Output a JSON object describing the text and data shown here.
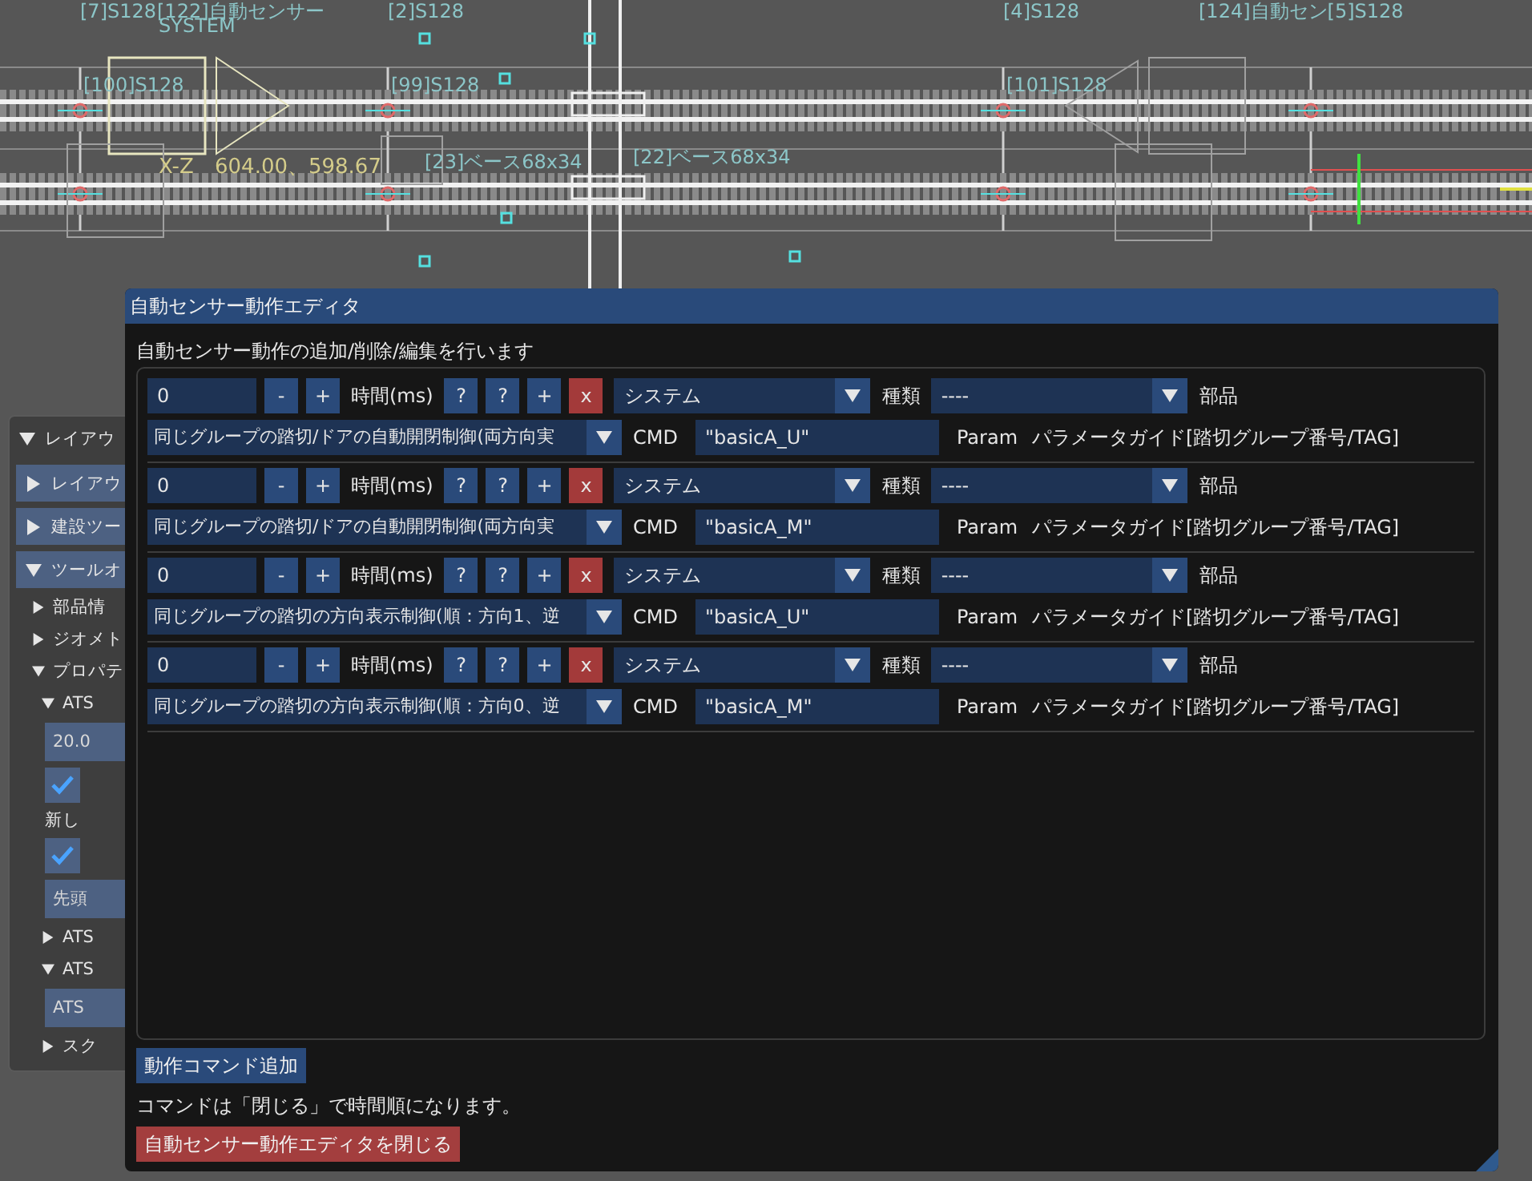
{
  "canvas": {
    "labels": [
      {
        "kind": "label",
        "text": "[7]S128"
      },
      {
        "kind": "label",
        "text": "[122]自動センサー"
      },
      {
        "kind": "label",
        "text": "SYSTEM"
      },
      {
        "kind": "label",
        "text": "[2]S128"
      },
      {
        "kind": "label",
        "text": "[4]S128"
      },
      {
        "kind": "label",
        "text": "[124]自動セン[5]S128"
      },
      {
        "kind": "label",
        "text": "[100]S128"
      },
      {
        "kind": "label",
        "text": "[99]S128"
      },
      {
        "kind": "label",
        "text": "[101]S128"
      },
      {
        "kind": "coordinate",
        "text": "X-Z"
      },
      {
        "kind": "coordinate",
        "text": "604.00、598.67"
      },
      {
        "kind": "label",
        "text": "[23]ベース68x34"
      },
      {
        "kind": "label",
        "text": "[22]ベース68x34"
      }
    ]
  },
  "side_panel": {
    "title": "レイアウ",
    "expanded": true,
    "items": [
      {
        "kind": "button",
        "label": "レイアウ",
        "expanded": false
      },
      {
        "kind": "button",
        "label": "建設ツー",
        "expanded": false
      },
      {
        "kind": "button",
        "label": "ツールオ",
        "expanded": true,
        "children": [
          {
            "kind": "node",
            "label": "部品情",
            "expanded": false
          },
          {
            "kind": "node",
            "label": "ジオメト",
            "expanded": false
          },
          {
            "kind": "node",
            "label": "プロパテ",
            "expanded": true,
            "children": [
              {
                "kind": "node",
                "label": "ATS",
                "expanded": true,
                "children": [
                  {
                    "kind": "field",
                    "value": "20.0"
                  },
                  {
                    "kind": "checkbox",
                    "checked": true
                  },
                  {
                    "kind": "text",
                    "label": "新し"
                  },
                  {
                    "kind": "checkbox",
                    "checked": true
                  },
                  {
                    "kind": "dropdown",
                    "value": "先頭"
                  }
                ]
              },
              {
                "kind": "node",
                "label": "ATS",
                "expanded": false
              },
              {
                "kind": "node",
                "label": "ATS",
                "expanded": true,
                "children": [
                  {
                    "kind": "action",
                    "label": "ATS"
                  }
                ]
              },
              {
                "kind": "node",
                "label": "スク",
                "expanded": false
              }
            ]
          }
        ]
      }
    ]
  },
  "dialog": {
    "title": "自動センサー動作エディタ",
    "description": "自動センサー動作の追加/削除/編集を行います",
    "commands": [
      {
        "time": "0",
        "steps": [
          "-",
          "+"
        ],
        "time_label": "時間(ms)",
        "tools": [
          "?",
          "?",
          "+"
        ],
        "delete": "x",
        "category": "システム",
        "category_label": "種類",
        "part": "----",
        "part_label": "部品",
        "action": "同じグループの踏切/ドアの自動開閉制御(両方向実",
        "cmd_label": "CMD",
        "cmd": "\"basicA_U\"",
        "param_label": "Param",
        "param": "パラメータガイド[踏切グループ番号/TAG]"
      },
      {
        "time": "0",
        "steps": [
          "-",
          "+"
        ],
        "time_label": "時間(ms)",
        "tools": [
          "?",
          "?",
          "+"
        ],
        "delete": "x",
        "category": "システム",
        "category_label": "種類",
        "part": "----",
        "part_label": "部品",
        "action": "同じグループの踏切/ドアの自動開閉制御(両方向実",
        "cmd_label": "CMD",
        "cmd": "\"basicA_M\"",
        "param_label": "Param",
        "param": "パラメータガイド[踏切グループ番号/TAG]"
      },
      {
        "time": "0",
        "steps": [
          "-",
          "+"
        ],
        "time_label": "時間(ms)",
        "tools": [
          "?",
          "?",
          "+"
        ],
        "delete": "x",
        "category": "システム",
        "category_label": "種類",
        "part": "----",
        "part_label": "部品",
        "action": "同じグループの踏切の方向表示制御(順：方向1、逆",
        "cmd_label": "CMD",
        "cmd": "\"basicA_U\"",
        "param_label": "Param",
        "param": "パラメータガイド[踏切グループ番号/TAG]"
      },
      {
        "time": "0",
        "steps": [
          "-",
          "+"
        ],
        "time_label": "時間(ms)",
        "tools": [
          "?",
          "?",
          "+"
        ],
        "delete": "x",
        "category": "システム",
        "category_label": "種類",
        "part": "----",
        "part_label": "部品",
        "action": "同じグループの踏切の方向表示制御(順：方向0、逆",
        "cmd_label": "CMD",
        "cmd": "\"basicA_M\"",
        "param_label": "Param",
        "param": "パラメータガイド[踏切グループ番号/TAG]"
      }
    ],
    "add_button": "動作コマンド追加",
    "note": "コマンドは「閉じる」で時間順になります。",
    "close_button": "自動センサー動作エディタを閉じる"
  }
}
